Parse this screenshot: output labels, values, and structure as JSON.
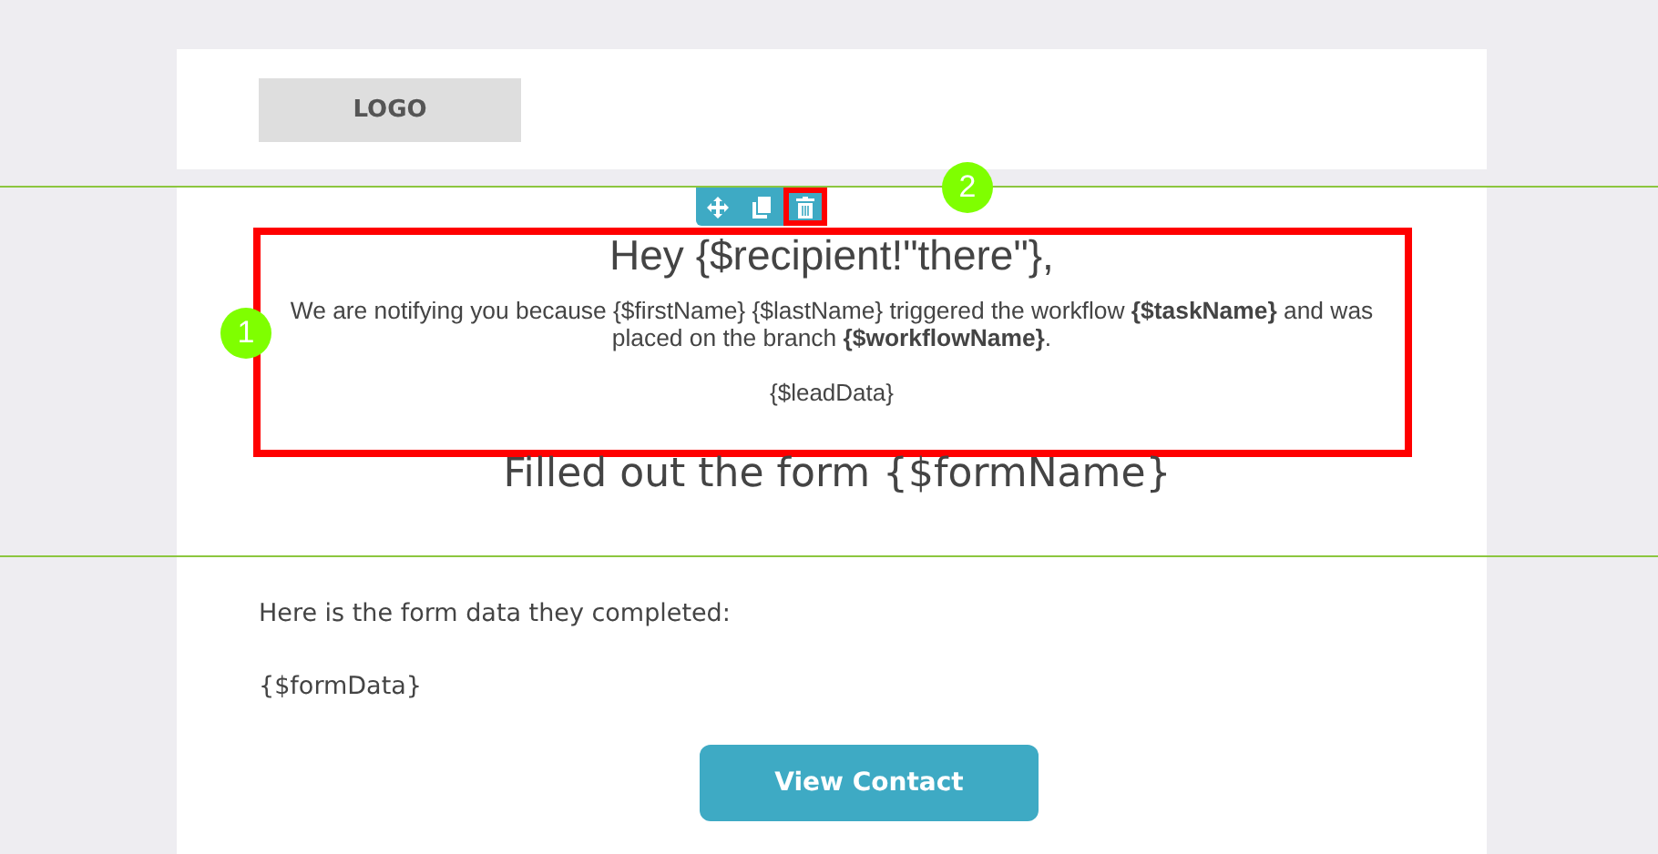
{
  "header": {
    "logo": "LOGO"
  },
  "block": {
    "toolbar": [
      {
        "kind": "move"
      },
      {
        "kind": "copy"
      },
      {
        "kind": "delete",
        "selected": true
      }
    ],
    "heading": "Hey {$recipient!\"there\"},",
    "paragraph": "We are notifying you because {$firstName} {$lastName} triggered the workflow **{$taskName}** and was placed on the branch **{$workflowName}**.",
    "lead_data": "{$leadData}"
  },
  "form_title": "Filled out the form {$formName}",
  "body": {
    "intro": "Here is the form data they completed:",
    "form_data": "{$formData}",
    "button": "View Contact"
  },
  "callouts": [
    "1",
    "2"
  ]
}
